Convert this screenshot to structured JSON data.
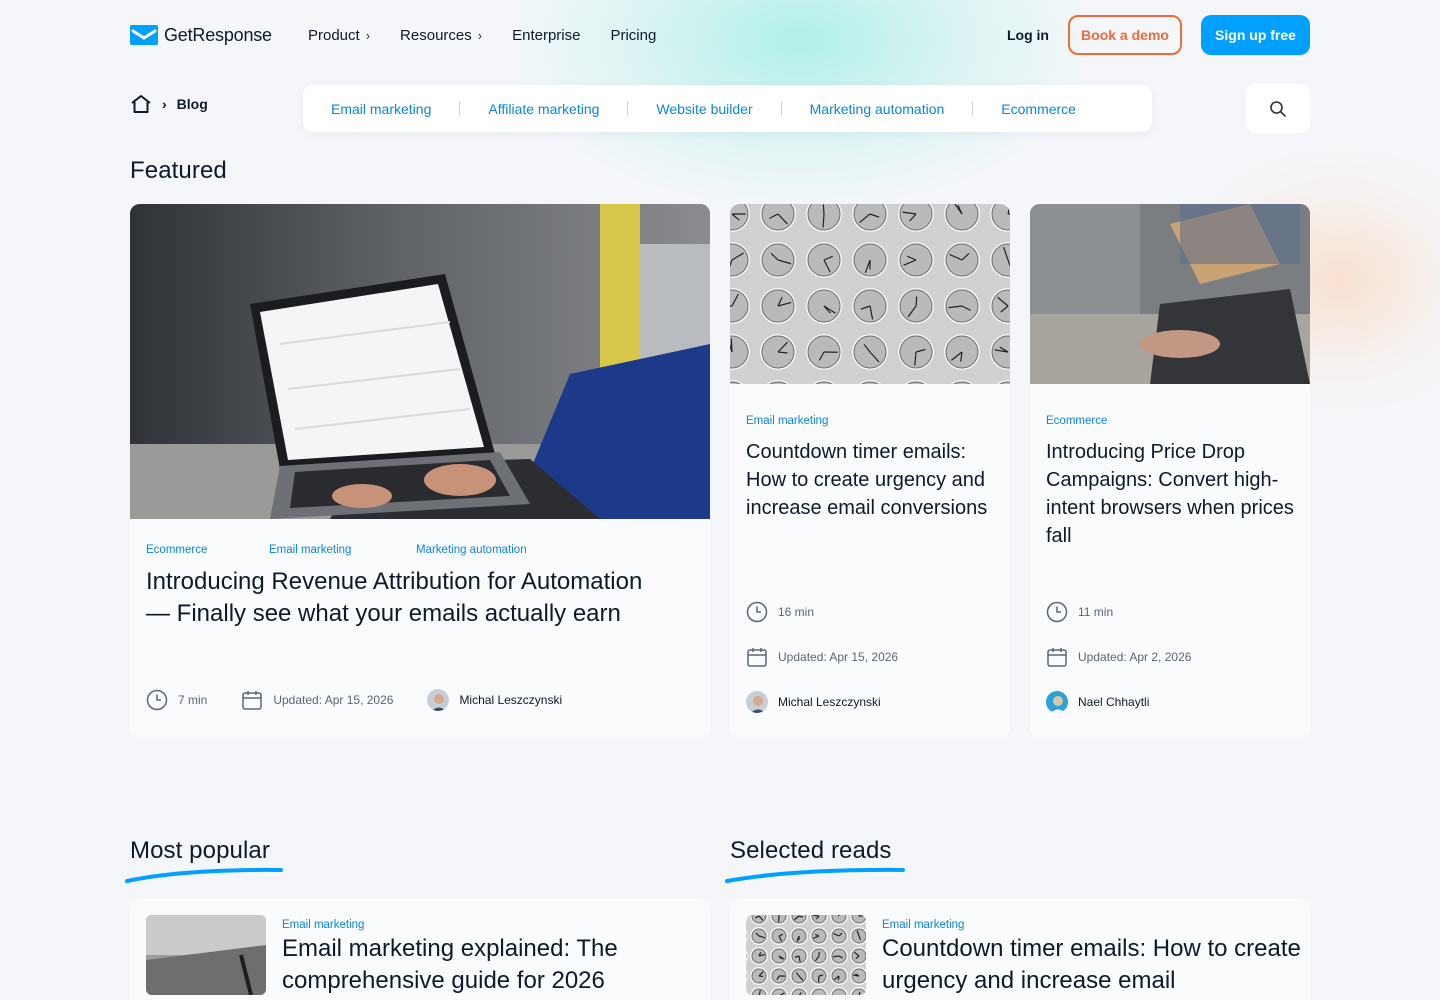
{
  "brand": {
    "name": "GetResponse",
    "accent": "#00a0ff",
    "orange": "#f06b3c",
    "link_blue": "#0b86d8"
  },
  "nav": {
    "items": [
      {
        "label": "Product",
        "has_chevron": true
      },
      {
        "label": "Resources",
        "has_chevron": true
      },
      {
        "label": "Enterprise",
        "has_chevron": false
      },
      {
        "label": "Pricing",
        "has_chevron": false
      }
    ],
    "chevron": "›",
    "login": "Log in",
    "book_demo": "Book a demo",
    "signup": "Sign up free"
  },
  "breadcrumb": {
    "home_icon": "home-icon",
    "separator": "›",
    "current": "Blog"
  },
  "categories": [
    "Email marketing",
    "Affiliate marketing",
    "Website builder",
    "Marketing automation",
    "Ecommerce"
  ],
  "search": {
    "icon": "search-icon"
  },
  "featured": {
    "heading": "Featured",
    "main": {
      "tags": [
        "Ecommerce",
        "Email marketing",
        "Marketing automation"
      ],
      "title": "Introducing Revenue Attribution for Automation — Finally see what your emails actually earn",
      "read_time": "7 min",
      "updated": "Updated: Apr 15, 2026",
      "author": "Michal Leszczynski"
    },
    "side": [
      {
        "tag": "Email marketing",
        "title": "Countdown timer emails: How to create urgency and increase email conversions",
        "read_time": "16 min",
        "updated": "Updated: Apr 15, 2026",
        "author": "Michal Leszczynski"
      },
      {
        "tag": "Ecommerce",
        "title": "Introducing Price Drop Campaigns: Convert high-intent browsers when prices fall",
        "read_time": "11 min",
        "updated": "Updated: Apr 2, 2026",
        "author": "Nael Chhaytli"
      }
    ]
  },
  "most_popular": {
    "heading": "Most popular",
    "first": {
      "tag": "Email marketing",
      "title": "Email marketing explained: The comprehensive guide for 2026"
    }
  },
  "selected_reads": {
    "heading": "Selected reads",
    "first": {
      "tag": "Email marketing",
      "title": "Countdown timer emails: How to create urgency and increase email"
    }
  }
}
